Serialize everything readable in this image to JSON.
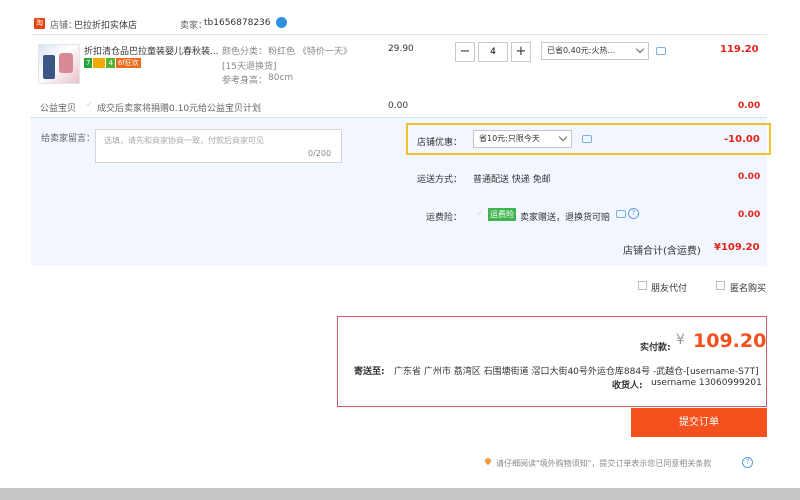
{
  "shop": {
    "store_label": "店铺：",
    "store_name": "巴拉折扣实体店",
    "seller_label": "卖家：",
    "seller_name": "tb1656878236",
    "shop_icon_text": "淘"
  },
  "item": {
    "title": "折扣清仓品巴拉童装婴儿春秋装...",
    "badges": [
      "7",
      "",
      "4",
      "6f狂欢"
    ],
    "color_label": "颜色分类：",
    "color_value": "粉红色 《特价一天》",
    "exchange": "[15天退换货]",
    "height_label": "参考身高：",
    "height_value": "80cm",
    "unit_price": "29.90",
    "quantity": "4",
    "discount_select": "已省0.40元:火热...",
    "subtotal": "119.20"
  },
  "charity": {
    "label": "公益宝贝",
    "text": "成交后卖家将捐赠0.10元给公益宝贝计划",
    "amount": "0.00",
    "total": "0.00"
  },
  "message": {
    "label": "给卖家留言：",
    "placeholder": "选填，请先和商家协商一致，付款后商家可见",
    "counter": "0/200"
  },
  "coupon": {
    "label": "店铺优惠：",
    "select": "省10元:只限今天",
    "amount": "-10.00"
  },
  "shipping": {
    "label": "运送方式：",
    "value": "普通配送 快递 免邮",
    "amount": "0.00"
  },
  "insurance": {
    "label": "运费险：",
    "tag": "运费险",
    "text": "卖家赠送，退换货可赔",
    "amount": "0.00"
  },
  "store_total": {
    "label": "店铺合计(含运费)",
    "value": "¥109.20"
  },
  "options": {
    "friend_pay": "朋友代付",
    "anonymous": "匿名购买"
  },
  "summary": {
    "paid_label": "实付款:",
    "currency": "¥",
    "amount": "109.20",
    "ship_to_label": "寄送至:",
    "address": "广东省 广州市 荔湾区 石围塘街道 滘口大街40号外运仓库884号 -武越仓-[username-S7T]",
    "recipient_label": "收货人:",
    "recipient": "username 13060999201"
  },
  "submit_label": "提交订单",
  "footer_note": "请仔细阅读\"境外购物须知\"，提交订单表示您已同意相关条款",
  "colors": {
    "accent": "#f4511e",
    "price_red": "#e2231a",
    "highlight": "#f2c12e",
    "panel_bg": "#f2f7ff"
  },
  "icons": [
    "shop-icon",
    "wangwang-icon",
    "chat-icon",
    "help-icon",
    "location-pin-icon",
    "chevron-down-icon",
    "check-icon"
  ]
}
